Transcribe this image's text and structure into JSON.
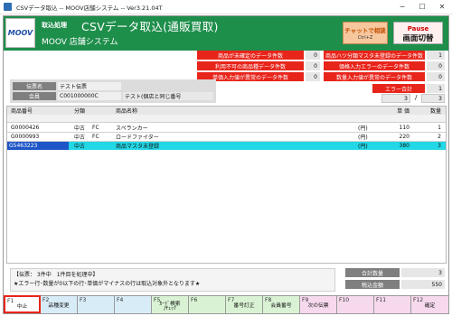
{
  "window": {
    "title": "CSVデータ取込 -- MOOV店舗システム -- Ver3.21.04T",
    "minimize": "─",
    "maximize": "☐",
    "close": "✕"
  },
  "header": {
    "logo": "MOOV",
    "section": "取込処理",
    "title": "CSVデータ取込(通販買取)",
    "system": "MOOV 店舗システム",
    "chat_button": "チャットで相談",
    "chat_shortcut": "Ctrl+Z",
    "pause_button": "Pause",
    "pause_sub": "画面切替"
  },
  "stats_left": [
    {
      "label": "商品が未確定のデータ件数",
      "value": "0"
    },
    {
      "label": "利用不可の商品種データ件数",
      "value": "0"
    },
    {
      "label": "単価入力値が異常のデータ件数",
      "value": "0"
    }
  ],
  "stats_right": [
    {
      "label": "商品ハツ分類マスタ未登録のデータ件数",
      "value": "1"
    },
    {
      "label": "価格入力エラーのデータ件数",
      "value": "0"
    },
    {
      "label": "数量入力値が異常のデータ件数",
      "value": "0"
    }
  ],
  "error_total": {
    "label": "エラー合計",
    "value": "1"
  },
  "info": {
    "slip_name_label": "伝票名",
    "slip_name_value": "テスト伝票",
    "member_label": "会員",
    "member_code": "C001000000C",
    "member_name": "テスト(個店と同じ番号"
  },
  "paging": {
    "current": "3",
    "separator": "/",
    "total": "3"
  },
  "grid": {
    "columns": {
      "code": "商品番号",
      "category": "分類",
      "name": "商品名称",
      "unit_price": "単 価",
      "quantity": "数量"
    },
    "rows": [
      {
        "code": "G0000426",
        "class": "中古",
        "type": "FC",
        "name": "スペランカー",
        "yen": "(円)",
        "price": "110",
        "qty": "1"
      },
      {
        "code": "G0000993",
        "class": "中古",
        "type": "FC",
        "name": "ロードファイター",
        "yen": "(円)",
        "price": "220",
        "qty": "2"
      },
      {
        "code": "G5463223",
        "class": "中古",
        "type": "",
        "name": "商品マスタ未登録",
        "yen": "(円)",
        "price": "380",
        "qty": "3"
      }
    ]
  },
  "message": {
    "line1": "【伝票： 3件中　1件目を処理中】",
    "line2": "★エラー行･数量が0以下の行･単価がマイナスの行は取込対象外となります★"
  },
  "totals": {
    "qty_label": "合計数量",
    "qty_value": "3",
    "amount_label": "税込金額",
    "amount_value": "550"
  },
  "fkeys": [
    {
      "key": "F1",
      "label": "中止",
      "color": "#ffffff"
    },
    {
      "key": "F2",
      "label": "品種変更",
      "color": "#d8ecf7"
    },
    {
      "key": "F3",
      "label": "",
      "color": "#d8ecf7"
    },
    {
      "key": "F4",
      "label": "",
      "color": "#d8ecf7"
    },
    {
      "key": "F5",
      "label": "ｶｰﾄﾞ検索\n/ﾁｪｯｸ",
      "color": "#d9f2d4"
    },
    {
      "key": "F6",
      "label": "",
      "color": "#d9f2d4"
    },
    {
      "key": "F7",
      "label": "番号訂正",
      "color": "#d9f2d4"
    },
    {
      "key": "F8",
      "label": "会員番号",
      "color": "#d9f2d4"
    },
    {
      "key": "F9",
      "label": "次の伝票",
      "color": "#f6d9ec"
    },
    {
      "key": "F10",
      "label": "",
      "color": "#f6d9ec"
    },
    {
      "key": "F11",
      "label": "",
      "color": "#f6d9ec"
    },
    {
      "key": "F12",
      "label": "確定",
      "color": "#f6d9ec"
    }
  ]
}
